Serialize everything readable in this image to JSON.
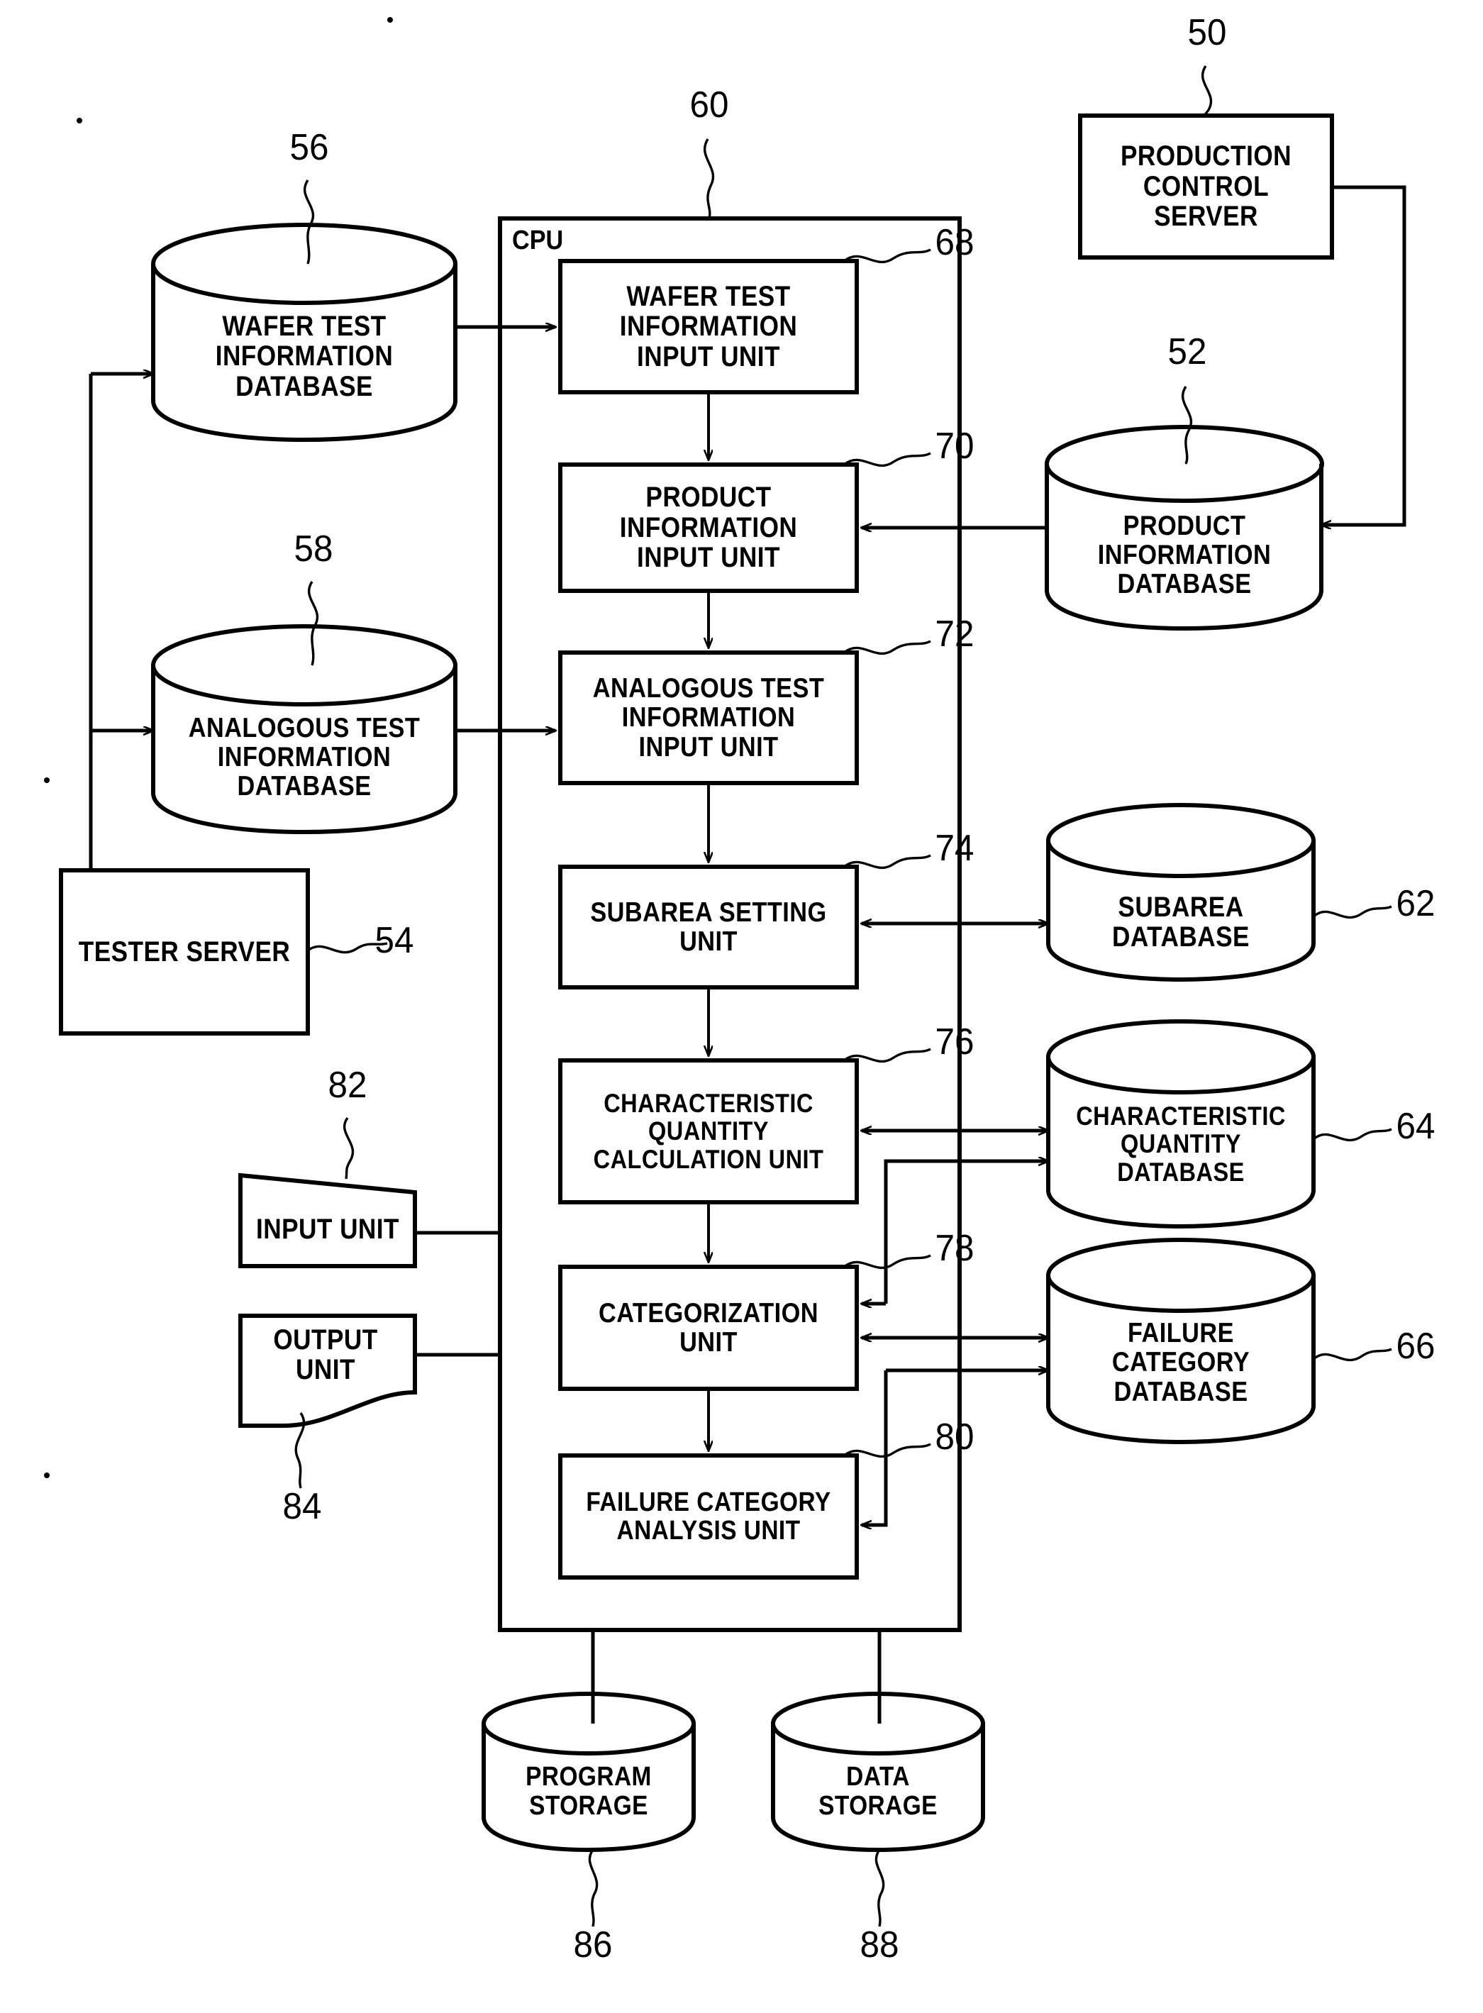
{
  "figure": {
    "container_label": "CPU",
    "container_ref": "60"
  },
  "cpu_units": [
    {
      "id": "wafer_test_input",
      "label": "WAFER TEST\nINFORMATION\nINPUT UNIT",
      "ref": "68"
    },
    {
      "id": "product_info_input",
      "label": "PRODUCT\nINFORMATION\nINPUT UNIT",
      "ref": "70"
    },
    {
      "id": "analogous_test_input",
      "label": "ANALOGOUS TEST\nINFORMATION\nINPUT UNIT",
      "ref": "72"
    },
    {
      "id": "subarea_setting",
      "label": "SUBAREA SETTING\nUNIT",
      "ref": "74"
    },
    {
      "id": "char_qty_calc",
      "label": "CHARACTERISTIC\nQUANTITY\nCALCULATION UNIT",
      "ref": "76"
    },
    {
      "id": "categorization",
      "label": "CATEGORIZATION\nUNIT",
      "ref": "78"
    },
    {
      "id": "failure_cat_analysis",
      "label": "FAILURE CATEGORY\nANALYSIS UNIT",
      "ref": "80"
    }
  ],
  "external_boxes": [
    {
      "id": "production_control_server",
      "label": "PRODUCTION\nCONTROL\nSERVER",
      "ref": "50"
    },
    {
      "id": "tester_server",
      "label": "TESTER SERVER",
      "ref": "54"
    }
  ],
  "io_units": [
    {
      "id": "input_unit",
      "label": "INPUT UNIT",
      "ref": "82"
    },
    {
      "id": "output_unit",
      "label": "OUTPUT UNIT",
      "ref": "84"
    }
  ],
  "databases": [
    {
      "id": "wafer_test_info_db",
      "label": "WAFER TEST\nINFORMATION\nDATABASE",
      "ref": "56"
    },
    {
      "id": "analogous_test_info_db",
      "label": "ANALOGOUS TEST\nINFORMATION\nDATABASE",
      "ref": "58"
    },
    {
      "id": "product_info_db",
      "label": "PRODUCT\nINFORMATION\nDATABASE",
      "ref": "52"
    },
    {
      "id": "subarea_db",
      "label": "SUBAREA\nDATABASE",
      "ref": "62"
    },
    {
      "id": "char_qty_db",
      "label": "CHARACTERISTIC\nQUANTITY\nDATABASE",
      "ref": "64"
    },
    {
      "id": "failure_category_db",
      "label": "FAILURE\nCATEGORY\nDATABASE",
      "ref": "66"
    },
    {
      "id": "program_storage",
      "label": "PROGRAM\nSTORAGE",
      "ref": "86"
    },
    {
      "id": "data_storage",
      "label": "DATA\nSTORAGE",
      "ref": "88"
    }
  ],
  "colors": {
    "stroke": "#000000",
    "background": "#ffffff"
  }
}
